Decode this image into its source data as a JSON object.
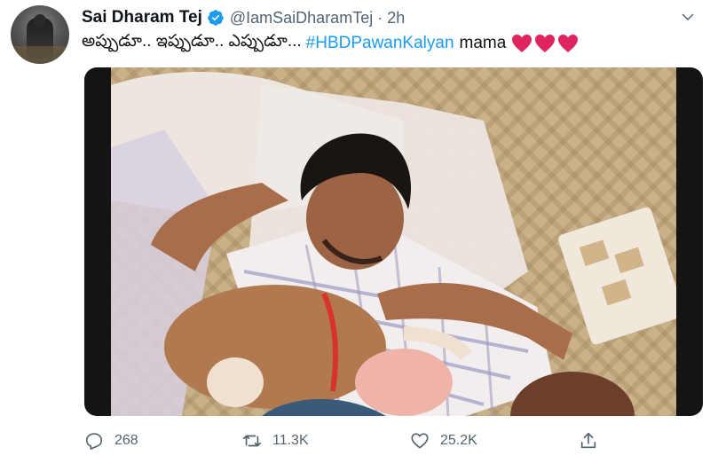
{
  "tweet": {
    "display_name": "Sai Dharam Tej",
    "handle": "@IamSaiDharamTej",
    "separator": "·",
    "time": "2h",
    "text_plain": "అప్పుడూ.. ఇప్పుడూ.. ఎప్పుడూ...",
    "hashtag": "#HBDPawanKalyan",
    "text_suffix": "mama",
    "heart_count": 3
  },
  "actions": {
    "replies": "268",
    "retweets": "11.3K",
    "likes": "25.2K"
  },
  "colors": {
    "accent": "#1d9bf0",
    "secondary_text": "#536471",
    "heart": "#e0245e"
  },
  "icons": {
    "verified": "verified-badge-icon",
    "caret": "chevron-down-icon",
    "reply": "reply-icon",
    "retweet": "retweet-icon",
    "like": "heart-icon",
    "share": "share-icon"
  }
}
